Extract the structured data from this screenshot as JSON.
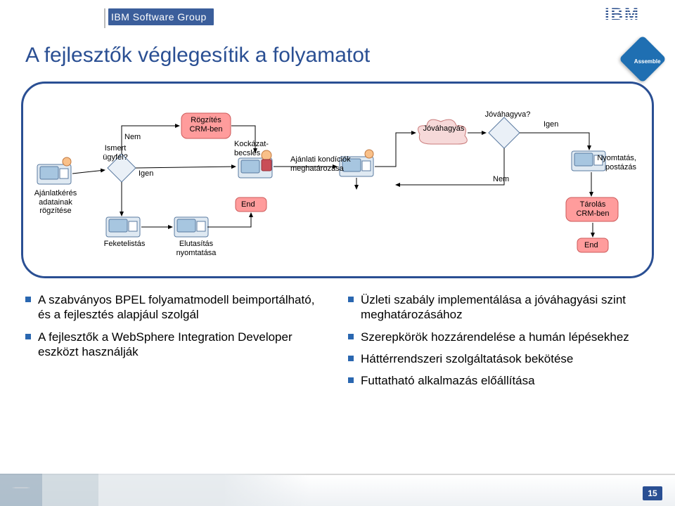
{
  "header": {
    "group_label": "IBM Software Group",
    "logo_name": "IBM"
  },
  "page_title": "A fejlesztők véglegesítik a folyamatot",
  "badge_label": "Assemble",
  "diagram": {
    "nodes": {
      "request_capture": {
        "label": "Ajánlatkérés adatainak rögzítése"
      },
      "known_customer": {
        "label": "Ismert ügyfél?"
      },
      "nem1": {
        "label": "Nem"
      },
      "igen1": {
        "label": "Igen"
      },
      "blacklist": {
        "label": "Feketelistás"
      },
      "reject_print": {
        "label": "Elutasítás nyomtatása"
      },
      "end1": {
        "label": "End"
      },
      "crm_record": {
        "label": "Rögzítés CRM-ben"
      },
      "risk_assess": {
        "label": "Kockázat-becslés"
      },
      "define_conditions": {
        "label": "Ajánlati kondíciók meghatározása"
      },
      "approval": {
        "label": "Jóváhagyás"
      },
      "approved_q": {
        "label": "Jóváhagyva?"
      },
      "nem2": {
        "label": "Nem"
      },
      "igen2": {
        "label": "Igen"
      },
      "print_mail": {
        "label": "Nyomtatás, postázás"
      },
      "crm_store": {
        "label": "Tárolás CRM-ben"
      },
      "end2": {
        "label": "End"
      }
    }
  },
  "bullets": {
    "left": [
      "A szabványos BPEL folyamatmodell beimportálható, és a fejlesztés alapjául szolgál",
      "A fejlesztők a WebSphere Integration Developer eszközt használják"
    ],
    "right": [
      "Üzleti szabály implementálása a jóváhagyási szint meghatározásához",
      "Szerepkörök hozzárendelése a humán lépésekhez",
      "Háttérrendszeri szolgáltatások bekötése",
      "Futtatható alkalmazás előállítása"
    ]
  },
  "page_number": "15"
}
